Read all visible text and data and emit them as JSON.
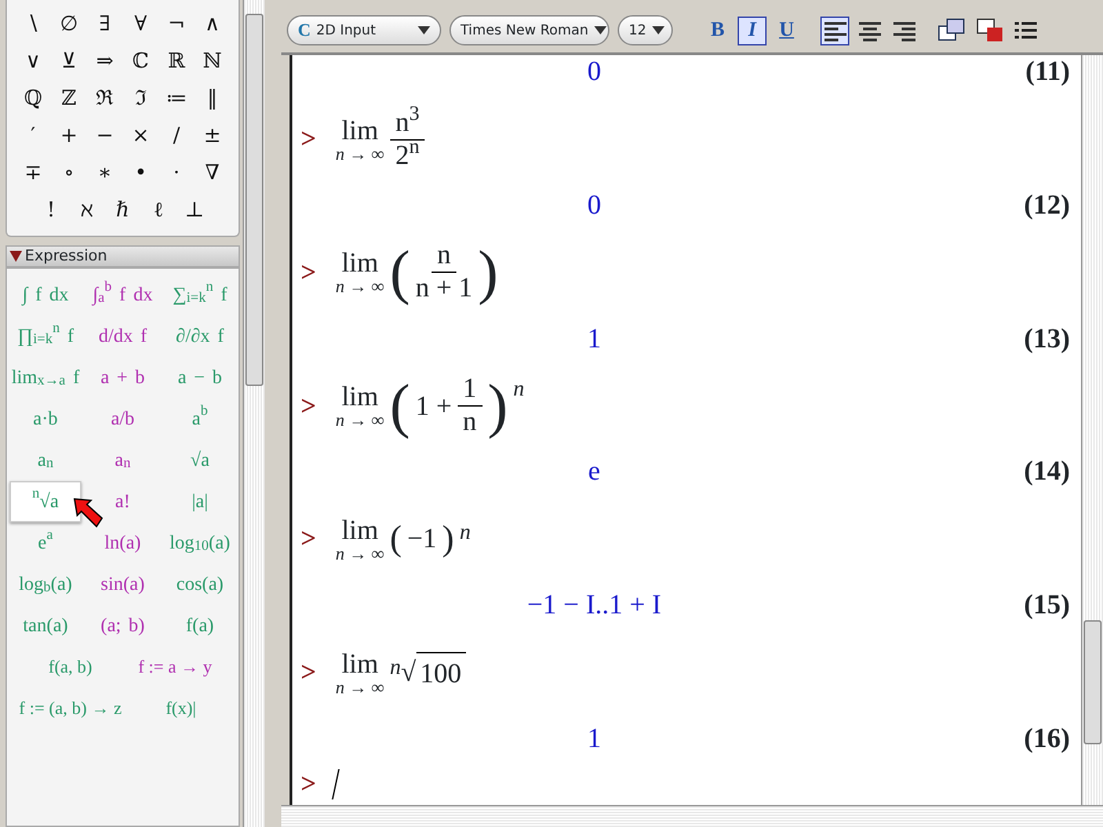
{
  "palette": {
    "symbols": [
      "∖",
      "∅",
      "∃",
      "∀",
      "¬",
      "∧",
      "∨",
      "⊻",
      "⇒",
      "ℂ",
      "ℝ",
      "ℕ",
      "ℚ",
      "ℤ",
      "ℜ",
      "ℑ",
      "≔",
      "‖",
      "′",
      "+",
      "−",
      "×",
      "/",
      "±",
      "∓",
      "∘",
      "∗",
      "•",
      "·",
      "∇",
      "!",
      "ℵ",
      "ℏ",
      "ℓ",
      "⊥"
    ],
    "expression_header": {
      "title": "Expression",
      "expanded": true
    },
    "expressions": [
      {
        "text": "∫ f dx",
        "selected": false
      },
      {
        "text": "∫$_{a}$$^{b}$ f dx",
        "selected": false
      },
      {
        "text": "∑$_{i=k}$$^{n}$ f",
        "selected": false
      },
      {
        "text": "∏$_{i=k}$$^{n}$ f",
        "selected": false
      },
      {
        "text": "d/dx f",
        "selected": false
      },
      {
        "text": "∂/∂x f",
        "selected": false
      },
      {
        "text": "lim$_{x→a}$ f",
        "selected": false
      },
      {
        "text": "a + b",
        "selected": false
      },
      {
        "text": "a − b",
        "selected": false
      },
      {
        "text": "a·b",
        "selected": false
      },
      {
        "text": "a/b",
        "selected": false
      },
      {
        "text": "a$^{b}$",
        "selected": false
      },
      {
        "text": "a$_{n}$",
        "selected": false
      },
      {
        "text": "a$_{n}$",
        "selected": false
      },
      {
        "text": "√a",
        "selected": false
      },
      {
        "text": "$^{n}$√a",
        "selected": true
      },
      {
        "text": "a!",
        "selected": false
      },
      {
        "text": "|a|",
        "selected": false
      },
      {
        "text": "e$^{a}$",
        "selected": false
      },
      {
        "text": "ln(a)",
        "selected": false
      },
      {
        "text": "log$_{10}$(a)",
        "selected": false
      },
      {
        "text": "log$_{b}$(a)",
        "selected": false
      },
      {
        "text": "sin(a)",
        "selected": false
      },
      {
        "text": "cos(a)",
        "selected": false
      },
      {
        "text": "tan(a)",
        "selected": false
      },
      {
        "text": "(a; b)",
        "selected": false
      },
      {
        "text": "f(a)",
        "selected": false
      },
      {
        "text": "f(a, b)",
        "selected": false
      },
      {
        "text": "f := a → y",
        "selected": false
      },
      {
        "text": "f := (a, b) → z",
        "selected": false
      },
      {
        "text": "f(x)|",
        "selected": false
      }
    ]
  },
  "toolbar": {
    "mode": {
      "icon": "C",
      "value": "2D Input"
    },
    "font": "Times New Roman",
    "size": "12",
    "style_buttons": [
      {
        "label": "B",
        "selected": false
      },
      {
        "label": "I",
        "selected": true
      },
      {
        "label": "U",
        "selected": false
      }
    ],
    "align_buttons": [
      {
        "kind": "left",
        "selected": true
      },
      {
        "kind": "center",
        "selected": false
      },
      {
        "kind": "right",
        "selected": false
      }
    ]
  },
  "document": {
    "top_output": {
      "value": "0",
      "label": "(11)"
    },
    "entries": [
      {
        "prompt": ">",
        "lim": "lim",
        "under": "n → ∞",
        "body": {
          "kind": "fraction",
          "num": "n$^{3}$",
          "den": "2$^{n}$"
        },
        "output": "0",
        "label": "(12)"
      },
      {
        "prompt": ">",
        "lim": "lim",
        "under": "n → ∞",
        "body": {
          "kind": "paren_fraction",
          "open": "(",
          "num": "n",
          "den": "n + 1",
          "close": ")"
        },
        "output": "1",
        "label": "(13)"
      },
      {
        "prompt": ">",
        "lim": "lim",
        "under": "n → ∞",
        "body": {
          "kind": "paren_sum",
          "open": "(",
          "lead": "1 +",
          "num": "1",
          "den": "n",
          "close": ")",
          "power": "n"
        },
        "output": "e",
        "label": "(14)"
      },
      {
        "prompt": ">",
        "lim": "lim",
        "under": "n → ∞",
        "body": {
          "kind": "paren",
          "open": "(",
          "inner": "−1",
          "close": ")",
          "power": "n"
        },
        "output": "−1 − I..1 + I",
        "label": "(15)"
      },
      {
        "prompt": ">",
        "lim": "lim",
        "under": "n → ∞",
        "body": {
          "kind": "root",
          "index": "n",
          "sign": "√",
          "radicand": "100"
        },
        "output": "1",
        "label": "(16)"
      }
    ],
    "prompt": ">"
  }
}
